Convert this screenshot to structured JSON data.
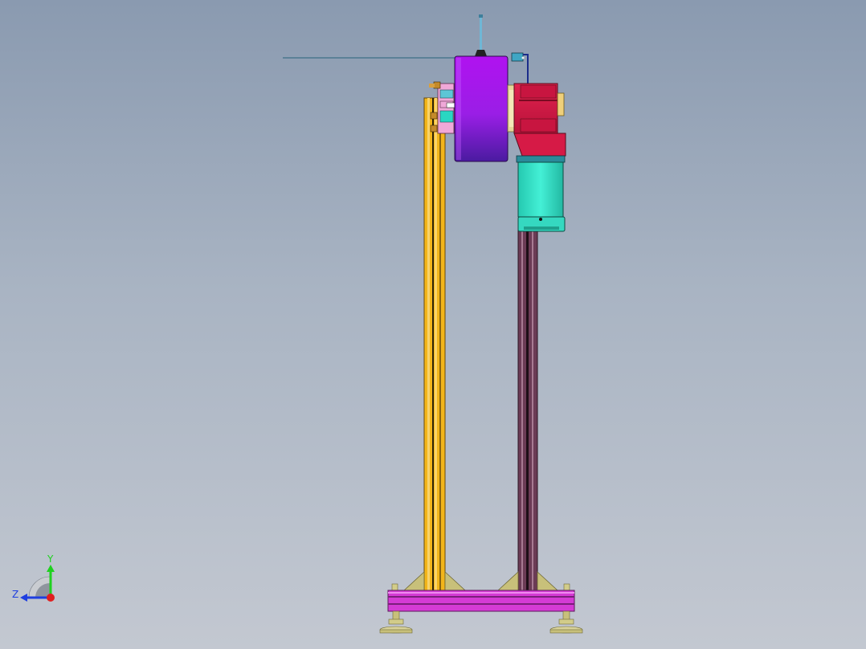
{
  "viewport": {
    "background_top": "#8a9ab0",
    "background_bottom": "#c3c8d1"
  },
  "model": {
    "components": [
      {
        "name": "left-column",
        "color": "#f2b51a"
      },
      {
        "name": "right-column",
        "color": "#6b3b55"
      },
      {
        "name": "base-beam",
        "color": "#d43bd4"
      },
      {
        "name": "drum",
        "color": "#9a1ee6"
      },
      {
        "name": "gearbox",
        "color": "#d61a46"
      },
      {
        "name": "motor",
        "color": "#33e0c4"
      },
      {
        "name": "gusset-plate",
        "color": "#c8c07a"
      },
      {
        "name": "leveling-foot",
        "color": "#d2cc8a"
      }
    ]
  },
  "triad": {
    "y_label": "Y",
    "z_label": "Z",
    "y_color": "#1fd11f",
    "z_color": "#1f3fe0",
    "x_color": "#e01f1f"
  }
}
